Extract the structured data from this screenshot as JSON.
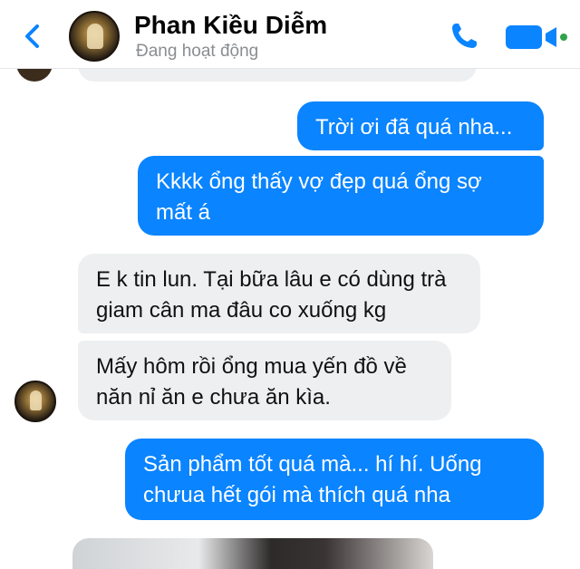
{
  "header": {
    "contact_name": "Phan Kiều Diễm",
    "status": "Đang hoạt động",
    "icons": [
      "back-chevron-icon",
      "avatar",
      "phone-icon",
      "video-camera-icon"
    ],
    "accent_color": "#0a84ff"
  },
  "messages": [
    {
      "direction": "out",
      "text": "Trời ơi đã quá nha..."
    },
    {
      "direction": "out",
      "text": "Kkkk ổng thấy vợ đẹp quá ổng sợ\nmất á"
    },
    {
      "direction": "in",
      "text": "E k tin lun. Tại bữa lâu e có dùng  trà\ngiam cân ma đâu co xuống kg"
    },
    {
      "direction": "in",
      "text": "Mấy hôm rồi ổng mua yến đồ về\nnăn nỉ ăn e chưa ăn kìa."
    },
    {
      "direction": "out",
      "text": "Sản phẩm tốt quá mà... hí hí. Uống\nchưua hết gói mà thích quá nha"
    }
  ],
  "colors": {
    "outgoing_bubble": "#0a84ff",
    "incoming_bubble": "#eeeff1",
    "status_text": "#8a8d91"
  }
}
